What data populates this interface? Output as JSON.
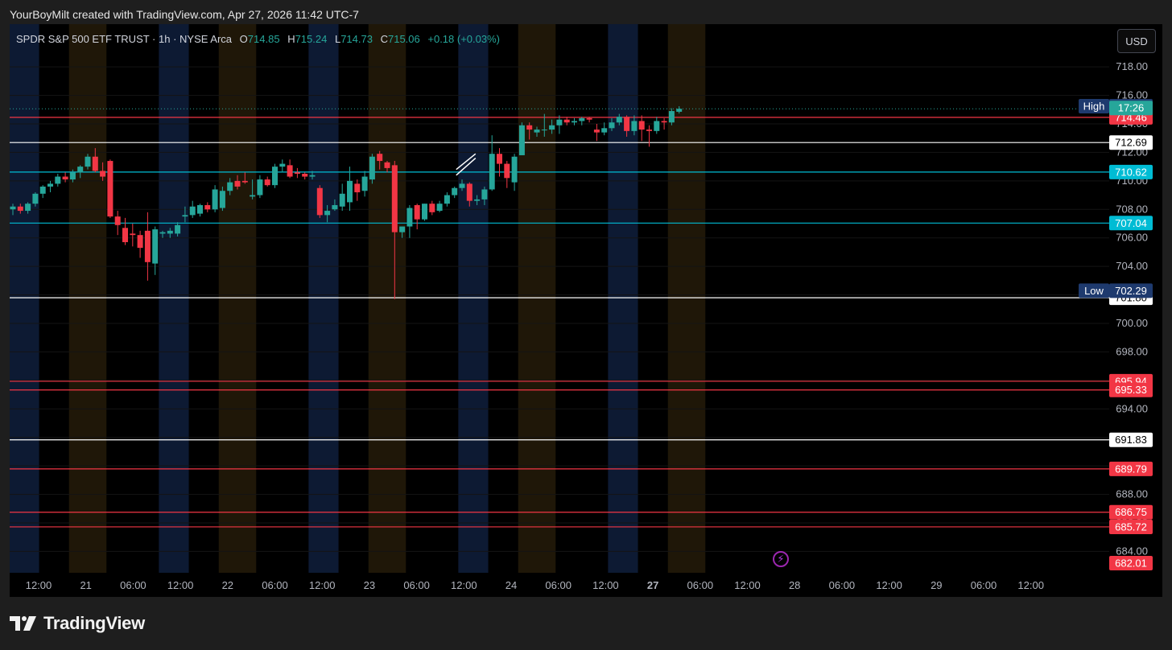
{
  "caption": "YourBoyMilt created with TradingView.com, Apr 27, 2026 11:42 UTC-7",
  "legend": {
    "title": "SPDR S&P 500 ETF TRUST · 1h · NYSE Arca",
    "open_label": "O",
    "open": "714.85",
    "high_label": "H",
    "high": "715.24",
    "low_label": "L",
    "low": "714.73",
    "close_label": "C",
    "close": "715.06",
    "change": "+0.18 (+0.03%)"
  },
  "currency_button": "USD",
  "logo_text": "TradingView",
  "colors": {
    "up": "#26a69a",
    "down": "#f23645",
    "teal_line": "#00bcd4",
    "red_line": "#f23645",
    "white_line": "#ffffff",
    "high_low_label": "#1e3a6e",
    "session_premarket": "#0d1a33",
    "session_afterhours": "#1f1708"
  },
  "chart_data": {
    "type": "candlestick",
    "interval": "1h",
    "symbol": "SPDR S&P 500 ETF TRUST",
    "exchange": "NYSE Arca",
    "ylim": [
      682.5,
      721.0
    ],
    "y_ticks": [
      "718.00",
      "716.00",
      "714.00",
      "712.00",
      "710.00",
      "708.00",
      "706.00",
      "704.00",
      "702.00",
      "700.00",
      "698.00",
      "696.00",
      "694.00",
      "692.00",
      "690.00",
      "688.00",
      "686.00",
      "684.00"
    ],
    "x_ticks": [
      "12:00",
      "21",
      "06:00",
      "12:00",
      "22",
      "06:00",
      "12:00",
      "23",
      "06:00",
      "12:00",
      "24",
      "06:00",
      "12:00",
      "27",
      "06:00",
      "12:00",
      "28",
      "06:00",
      "12:00",
      "29",
      "06:00",
      "12:00"
    ],
    "bold_x_ticks": [
      "27"
    ],
    "horizontal_levels": [
      {
        "value": 714.46,
        "label": "714.46",
        "color": "red"
      },
      {
        "value": 712.69,
        "label": "712.69",
        "color": "white"
      },
      {
        "value": 710.62,
        "label": "710.62",
        "color": "teal"
      },
      {
        "value": 707.04,
        "label": "707.04",
        "color": "teal"
      },
      {
        "value": 701.8,
        "label": "701.80",
        "color": "white"
      },
      {
        "value": 695.94,
        "label": "695.94",
        "color": "red"
      },
      {
        "value": 695.33,
        "label": "695.33",
        "color": "red"
      },
      {
        "value": 691.83,
        "label": "691.83",
        "color": "white"
      },
      {
        "value": 689.79,
        "label": "689.79",
        "color": "red"
      },
      {
        "value": 686.75,
        "label": "686.75",
        "color": "red"
      },
      {
        "value": 685.72,
        "label": "685.72",
        "color": "red"
      }
    ],
    "markers": [
      {
        "label": "High",
        "value": 715.24,
        "price_label": "715.24"
      },
      {
        "label": "Low",
        "value": 702.29,
        "price_label": "702.29"
      }
    ],
    "last_price": 715.06,
    "countdown": "17:26",
    "bottom_price_label": "682.01",
    "sessions": [
      {
        "type": "premarket",
        "start": -0.5,
        "end": 3.5
      },
      {
        "type": "afterhours",
        "start": 7.5,
        "end": 12.5
      },
      {
        "type": "premarket",
        "start": 19.5,
        "end": 23.5
      },
      {
        "type": "afterhours",
        "start": 27.5,
        "end": 32.5
      },
      {
        "type": "premarket",
        "start": 39.5,
        "end": 43.5
      },
      {
        "type": "afterhours",
        "start": 47.5,
        "end": 52.5
      },
      {
        "type": "premarket",
        "start": 59.5,
        "end": 63.5
      },
      {
        "type": "afterhours",
        "start": 67.5,
        "end": 72.5
      },
      {
        "type": "premarket",
        "start": 79.5,
        "end": 83.5
      },
      {
        "type": "afterhours",
        "start": 87.5,
        "end": 92.5
      }
    ],
    "candles": [
      [
        708.0,
        708.4,
        707.6,
        708.2
      ],
      [
        708.2,
        708.4,
        707.7,
        707.9
      ],
      [
        707.9,
        708.5,
        707.7,
        708.4
      ],
      [
        708.4,
        709.2,
        708.2,
        709.1
      ],
      [
        709.1,
        709.7,
        708.8,
        709.6
      ],
      [
        709.6,
        710.0,
        709.2,
        709.8
      ],
      [
        709.8,
        710.5,
        709.6,
        710.3
      ],
      [
        710.3,
        710.6,
        709.9,
        710.1
      ],
      [
        710.1,
        710.8,
        709.9,
        710.6
      ],
      [
        710.6,
        711.1,
        710.2,
        711.0
      ],
      [
        711.0,
        711.9,
        710.8,
        711.7
      ],
      [
        711.7,
        712.3,
        710.6,
        710.7
      ],
      [
        710.7,
        711.3,
        710.0,
        710.3
      ],
      [
        711.4,
        711.5,
        707.4,
        707.5
      ],
      [
        707.5,
        707.9,
        706.2,
        706.9
      ],
      [
        706.7,
        707.4,
        705.5,
        705.7
      ],
      [
        706.3,
        707.0,
        705.4,
        706.2
      ],
      [
        706.2,
        706.5,
        704.6,
        705.3
      ],
      [
        706.5,
        707.8,
        703.0,
        704.3
      ],
      [
        704.2,
        706.8,
        703.4,
        706.6
      ],
      [
        706.3,
        706.5,
        706.0,
        706.4
      ],
      [
        706.3,
        706.7,
        706.0,
        706.5
      ],
      [
        706.3,
        707.1,
        706.1,
        706.9
      ],
      [
        707.5,
        708.2,
        707.1,
        707.6
      ],
      [
        707.6,
        708.6,
        707.4,
        708.2
      ],
      [
        707.7,
        708.4,
        707.5,
        708.3
      ],
      [
        708.3,
        708.5,
        707.8,
        708.0
      ],
      [
        708.0,
        709.7,
        707.8,
        709.4
      ],
      [
        708.1,
        709.6,
        707.9,
        709.3
      ],
      [
        709.3,
        710.2,
        709.0,
        709.9
      ],
      [
        710.0,
        710.4,
        709.4,
        709.6
      ],
      [
        710.0,
        710.6,
        709.8,
        709.9
      ],
      [
        708.9,
        710.1,
        708.7,
        709.0
      ],
      [
        709.0,
        710.4,
        708.8,
        710.1
      ],
      [
        710.1,
        710.3,
        709.6,
        709.7
      ],
      [
        709.7,
        711.2,
        709.5,
        711.0
      ],
      [
        711.0,
        711.5,
        710.6,
        711.2
      ],
      [
        711.1,
        711.5,
        710.2,
        710.3
      ],
      [
        710.6,
        710.9,
        710.2,
        710.5
      ],
      [
        710.5,
        710.6,
        710.1,
        710.3
      ],
      [
        710.3,
        710.7,
        710.1,
        710.4
      ],
      [
        709.5,
        709.7,
        707.4,
        707.6
      ],
      [
        707.6,
        708.3,
        707.1,
        707.9
      ],
      [
        708.0,
        708.7,
        707.9,
        708.3
      ],
      [
        708.2,
        709.8,
        707.9,
        709.1
      ],
      [
        708.5,
        711.0,
        707.9,
        710.0
      ],
      [
        709.8,
        710.1,
        708.6,
        709.2
      ],
      [
        709.3,
        710.7,
        708.9,
        710.3
      ],
      [
        710.1,
        711.9,
        709.8,
        711.7
      ],
      [
        711.9,
        712.1,
        710.8,
        711.4
      ],
      [
        711.3,
        711.4,
        710.6,
        710.9
      ],
      [
        711.1,
        711.4,
        701.7,
        706.4
      ],
      [
        706.4,
        706.8,
        706.0,
        706.8
      ],
      [
        706.8,
        708.3,
        706.0,
        708.1
      ],
      [
        708.3,
        708.4,
        706.6,
        707.3
      ],
      [
        707.3,
        708.4,
        707.2,
        708.4
      ],
      [
        708.4,
        708.6,
        707.6,
        707.8
      ],
      [
        707.9,
        708.6,
        707.8,
        708.4
      ],
      [
        708.4,
        709.2,
        708.2,
        709.0
      ],
      [
        709.0,
        709.6,
        708.8,
        709.5
      ],
      [
        709.5,
        710.1,
        709.3,
        709.8
      ],
      [
        709.8,
        709.9,
        708.2,
        708.6
      ],
      [
        708.6,
        709.0,
        708.3,
        708.7
      ],
      [
        708.7,
        709.6,
        708.3,
        709.4
      ],
      [
        709.4,
        713.2,
        709.3,
        711.9
      ],
      [
        711.9,
        712.3,
        710.3,
        711.2
      ],
      [
        711.2,
        711.4,
        709.5,
        710.2
      ],
      [
        709.9,
        711.9,
        709.3,
        711.7
      ],
      [
        711.8,
        714.1,
        711.8,
        713.9
      ],
      [
        713.9,
        714.1,
        712.9,
        713.6
      ],
      [
        713.4,
        713.8,
        713.1,
        713.6
      ],
      [
        713.6,
        714.7,
        713.1,
        713.6
      ],
      [
        713.6,
        714.3,
        713.3,
        713.9
      ],
      [
        713.9,
        714.6,
        713.3,
        714.3
      ],
      [
        714.3,
        714.5,
        713.9,
        714.1
      ],
      [
        714.1,
        714.4,
        713.9,
        714.2
      ],
      [
        714.2,
        714.5,
        713.9,
        714.4
      ],
      [
        714.4,
        714.5,
        714.1,
        714.3
      ],
      [
        713.6,
        714.0,
        712.8,
        713.4
      ],
      [
        713.4,
        714.1,
        713.2,
        713.7
      ],
      [
        713.7,
        714.4,
        713.5,
        714.1
      ],
      [
        714.1,
        714.7,
        713.9,
        714.5
      ],
      [
        714.5,
        714.6,
        713.1,
        713.5
      ],
      [
        713.5,
        714.6,
        713.2,
        714.2
      ],
      [
        714.2,
        714.6,
        712.8,
        713.6
      ],
      [
        713.6,
        713.9,
        712.4,
        713.5
      ],
      [
        713.5,
        714.5,
        713.3,
        714.2
      ],
      [
        714.2,
        714.4,
        713.6,
        714.1
      ],
      [
        714.1,
        715.1,
        713.9,
        714.9
      ],
      [
        714.85,
        715.24,
        714.73,
        715.06
      ]
    ]
  }
}
